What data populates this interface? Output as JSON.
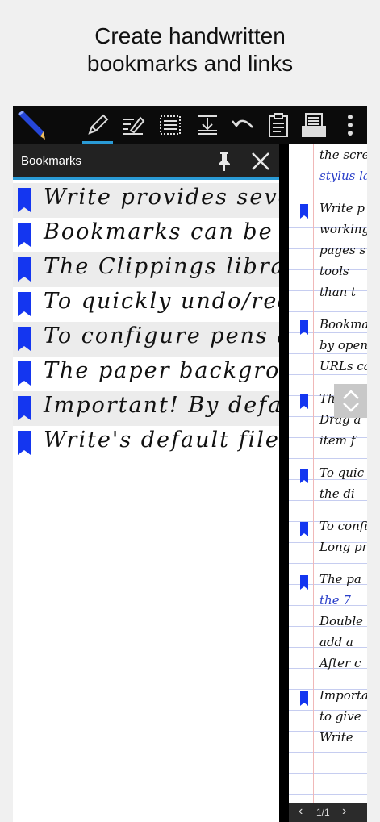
{
  "caption": {
    "line1": "Create handwritten",
    "line2": "bookmarks and links"
  },
  "toolbar": {
    "icons": [
      "app-logo-icon",
      "pen-icon",
      "eraser-icon",
      "select-icon",
      "insert-space-icon",
      "undo-icon",
      "clipboard-icon",
      "bookmarks-tray-icon",
      "more-icon"
    ],
    "accent": "#2a9bd6"
  },
  "panel": {
    "title": "Bookmarks",
    "items": [
      {
        "text": "Write provides several t"
      },
      {
        "text": "Bookmarks can be add"
      },
      {
        "text": "The Clippings library"
      },
      {
        "text": "To quickly undo/redo w"
      },
      {
        "text": "To configure pens and ch"
      },
      {
        "text": "The paper background"
      },
      {
        "text": "Important! By defau"
      },
      {
        "text": "Write's default file fo"
      }
    ],
    "flag_color": "#1436f0"
  },
  "page": {
    "lines": [
      {
        "text": "the scree",
        "blue": false
      },
      {
        "text": "stylus la",
        "blue": true
      },
      {
        "text": "Write p",
        "blue": false,
        "flag": true
      },
      {
        "text": "working",
        "blue": false
      },
      {
        "text": "pages s",
        "blue": false
      },
      {
        "text": "tools",
        "blue": false
      },
      {
        "text": "than t",
        "blue": false
      },
      {
        "text": "Bookmar",
        "blue": false,
        "flag": true
      },
      {
        "text": "by openi",
        "blue": false
      },
      {
        "text": "URLs car",
        "blue": false
      },
      {
        "text": "The Cl",
        "blue": false,
        "flag": true
      },
      {
        "text": "Drag a",
        "blue": false
      },
      {
        "text": "item f",
        "blue": false
      },
      {
        "text": "To quic",
        "blue": false,
        "flag": true
      },
      {
        "text": "the di",
        "blue": false
      },
      {
        "text": "To confi",
        "blue": false,
        "flag": true
      },
      {
        "text": "Long pre",
        "blue": false
      },
      {
        "text": "The pa",
        "blue": false,
        "flag": true
      },
      {
        "text": "the 7",
        "blue": true
      },
      {
        "text": "Double t",
        "blue": false
      },
      {
        "text": "add a",
        "blue": false
      },
      {
        "text": "After c",
        "blue": false
      },
      {
        "text": "Importa",
        "blue": false,
        "flag": true
      },
      {
        "text": "to give",
        "blue": false
      },
      {
        "text": "Write",
        "blue": false
      }
    ],
    "footer": {
      "prev": "‹",
      "page_indicator": "1/1",
      "next": "›"
    }
  }
}
